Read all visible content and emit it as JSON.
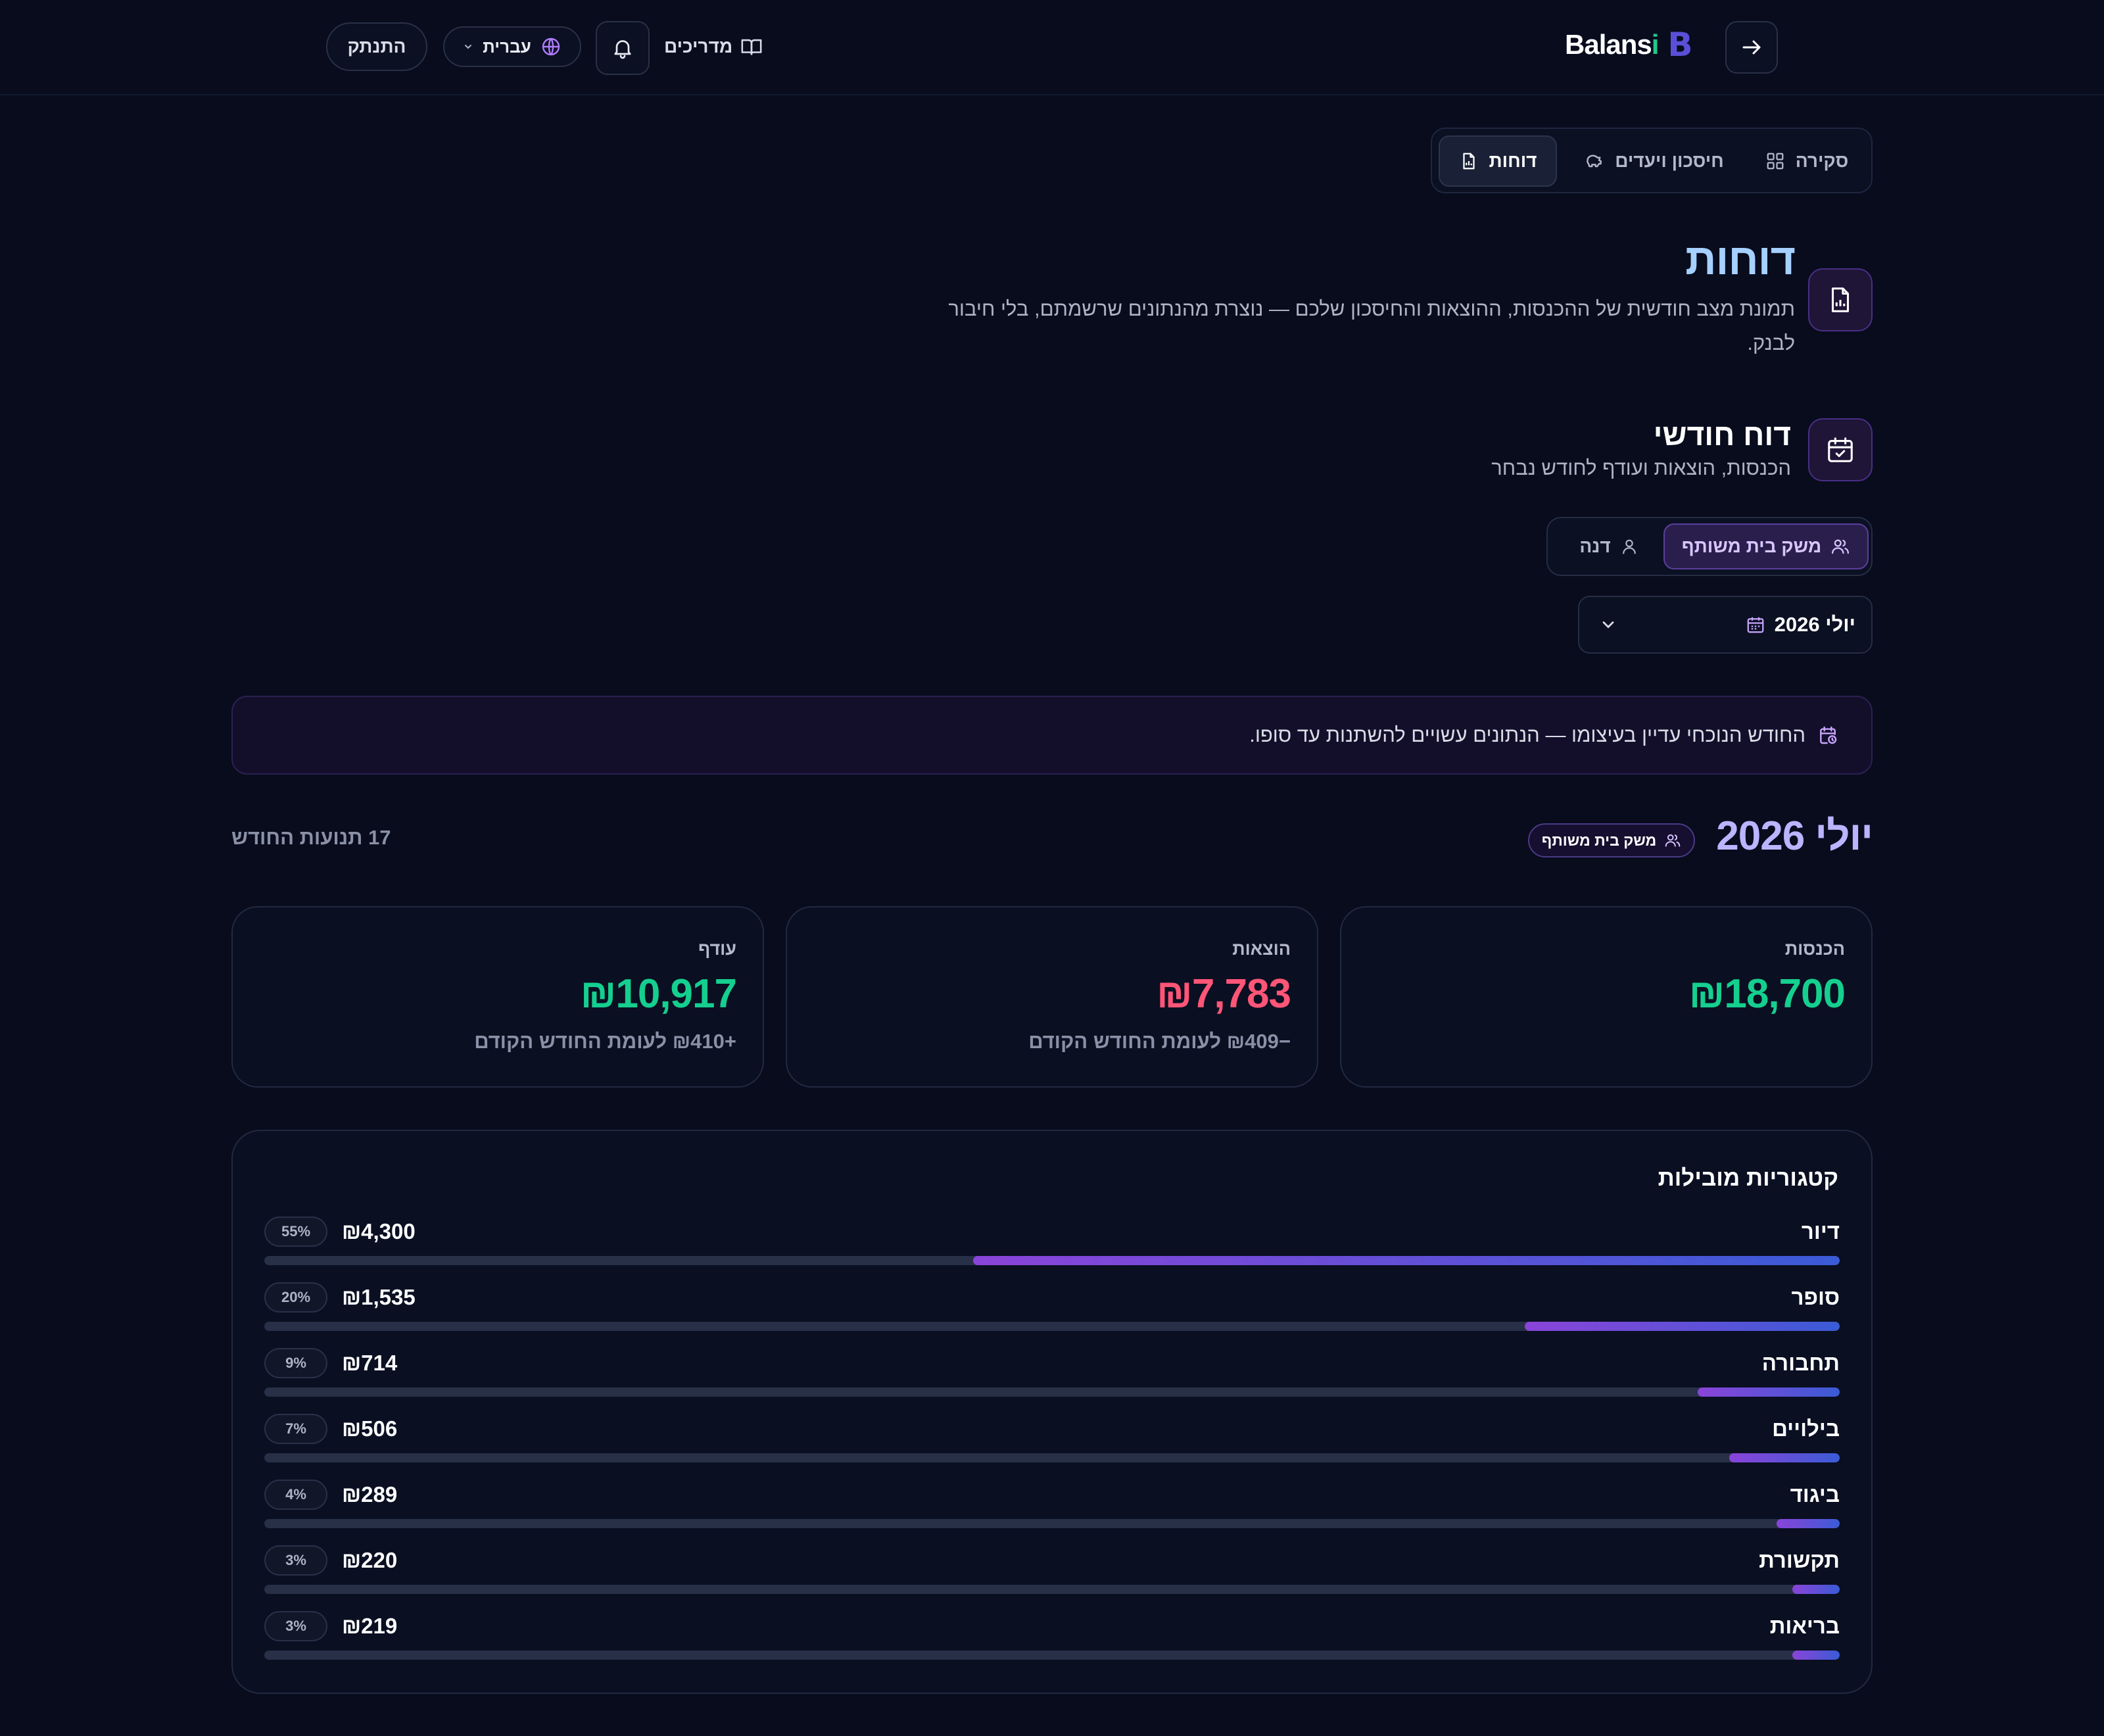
{
  "header": {
    "logout_label": "התנתק",
    "language_label": "עברית",
    "guides_label": "מדריכים",
    "brand_name": "Balans",
    "brand_accent": "i",
    "brand_mark": "B"
  },
  "tabs": [
    {
      "label": "דוחות",
      "icon": "report-file-icon",
      "active": true
    },
    {
      "label": "חיסכון ויעדים",
      "icon": "piggy-bank-icon",
      "active": false
    },
    {
      "label": "סקירה",
      "icon": "grid-icon",
      "active": false
    }
  ],
  "page": {
    "title": "דוחות",
    "subtitle": "תמונת מצב חודשית של ההכנסות, ההוצאות והחיסכון שלכם — נוצרת מהנתונים שרשמתם, בלי חיבור לבנק."
  },
  "monthly_report": {
    "title": "דוח חודשי",
    "subtitle": "הכנסות, הוצאות ועודף לחודש נבחר",
    "toggle": {
      "shared_label": "משק בית משותף",
      "personal_label": "דנה",
      "selected": "shared"
    },
    "month_select_value": "יולי 2026",
    "notice": "החודש הנוכחי עדיין בעיצומו — הנתונים עשויים להשתנות עד סופו."
  },
  "summary": {
    "month_heading": "יולי 2026",
    "scope_chip": "משק בית משותף",
    "transactions_count": "17 תנועות החודש",
    "cards": [
      {
        "label": "הכנסות",
        "value": "₪18,700",
        "comparison": "",
        "color": "#15cf8f"
      },
      {
        "label": "הוצאות",
        "value": "₪7,783",
        "comparison": "−₪409 לעומת החודש הקודם",
        "color": "#ff5577"
      },
      {
        "label": "עודף",
        "value": "₪10,917",
        "comparison": "+₪410 לעומת החודש הקודם",
        "color": "#15cf8f"
      }
    ]
  },
  "categories": {
    "title": "קטגוריות מובילות",
    "items": [
      {
        "name": "דיור",
        "amount": "₪4,300",
        "percent": "55%",
        "share": 0.55
      },
      {
        "name": "סופר",
        "amount": "₪1,535",
        "percent": "20%",
        "share": 0.2
      },
      {
        "name": "תחבורה",
        "amount": "₪714",
        "percent": "9%",
        "share": 0.09
      },
      {
        "name": "בילויים",
        "amount": "₪506",
        "percent": "7%",
        "share": 0.07
      },
      {
        "name": "ביגוד",
        "amount": "₪289",
        "percent": "4%",
        "share": 0.04
      },
      {
        "name": "תקשורת",
        "amount": "₪220",
        "percent": "3%",
        "share": 0.03
      },
      {
        "name": "בריאות",
        "amount": "₪219",
        "percent": "3%",
        "share": 0.03
      }
    ]
  },
  "colors": {
    "accent": "#8a44d8",
    "bar_end": "#3b5bd6",
    "positive": "#15cf8f",
    "negative": "#ff5577"
  }
}
